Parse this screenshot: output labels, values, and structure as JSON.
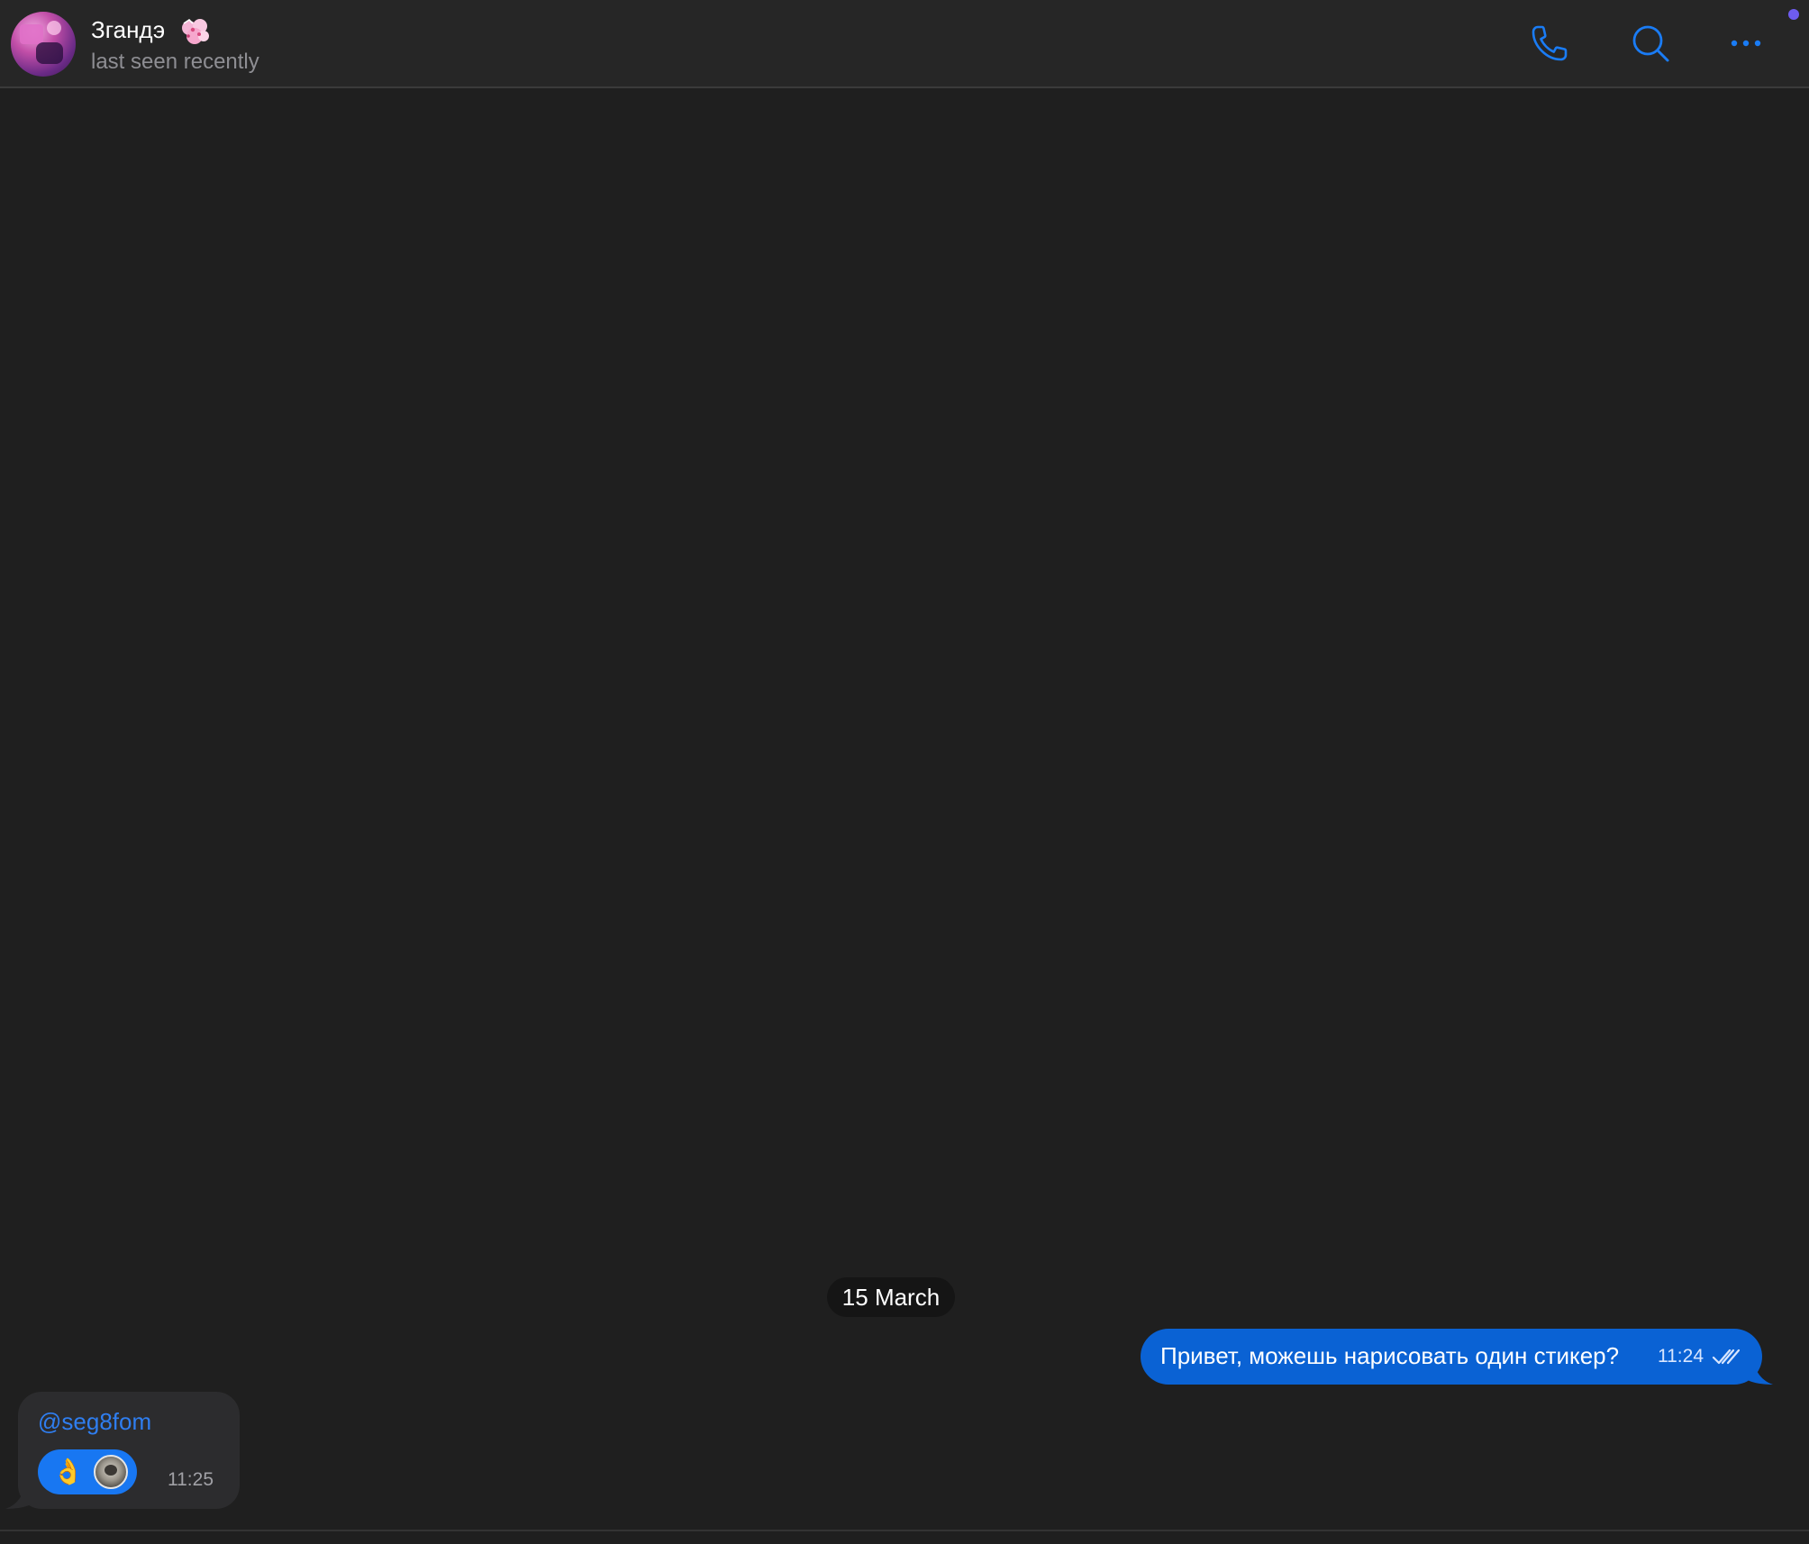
{
  "header": {
    "contact_name": "Згандэ",
    "contact_status": "last seen recently",
    "name_emoji_icon": "cherry-blossom-sticker-icon",
    "buttons": {
      "call": "phone-icon",
      "search": "search-icon",
      "more": "more-icon"
    }
  },
  "chat": {
    "date_separator": "15 March",
    "messages": [
      {
        "direction": "outgoing",
        "text": "Привет, можешь нарисовать один стикер?",
        "time": "11:24",
        "status": "read"
      },
      {
        "direction": "incoming",
        "mention": "@seg8fom",
        "time": "11:25",
        "reaction": {
          "emoji": "👌",
          "icon": "ok-hand-icon"
        }
      }
    ]
  },
  "colors": {
    "accent": "#1877f2",
    "outgoing_bubble": "#0a62d4",
    "incoming_bubble": "#2c2c2e",
    "background": "#1f1f1f",
    "header_background": "#262626",
    "online_dot": "#6e5cf0"
  }
}
